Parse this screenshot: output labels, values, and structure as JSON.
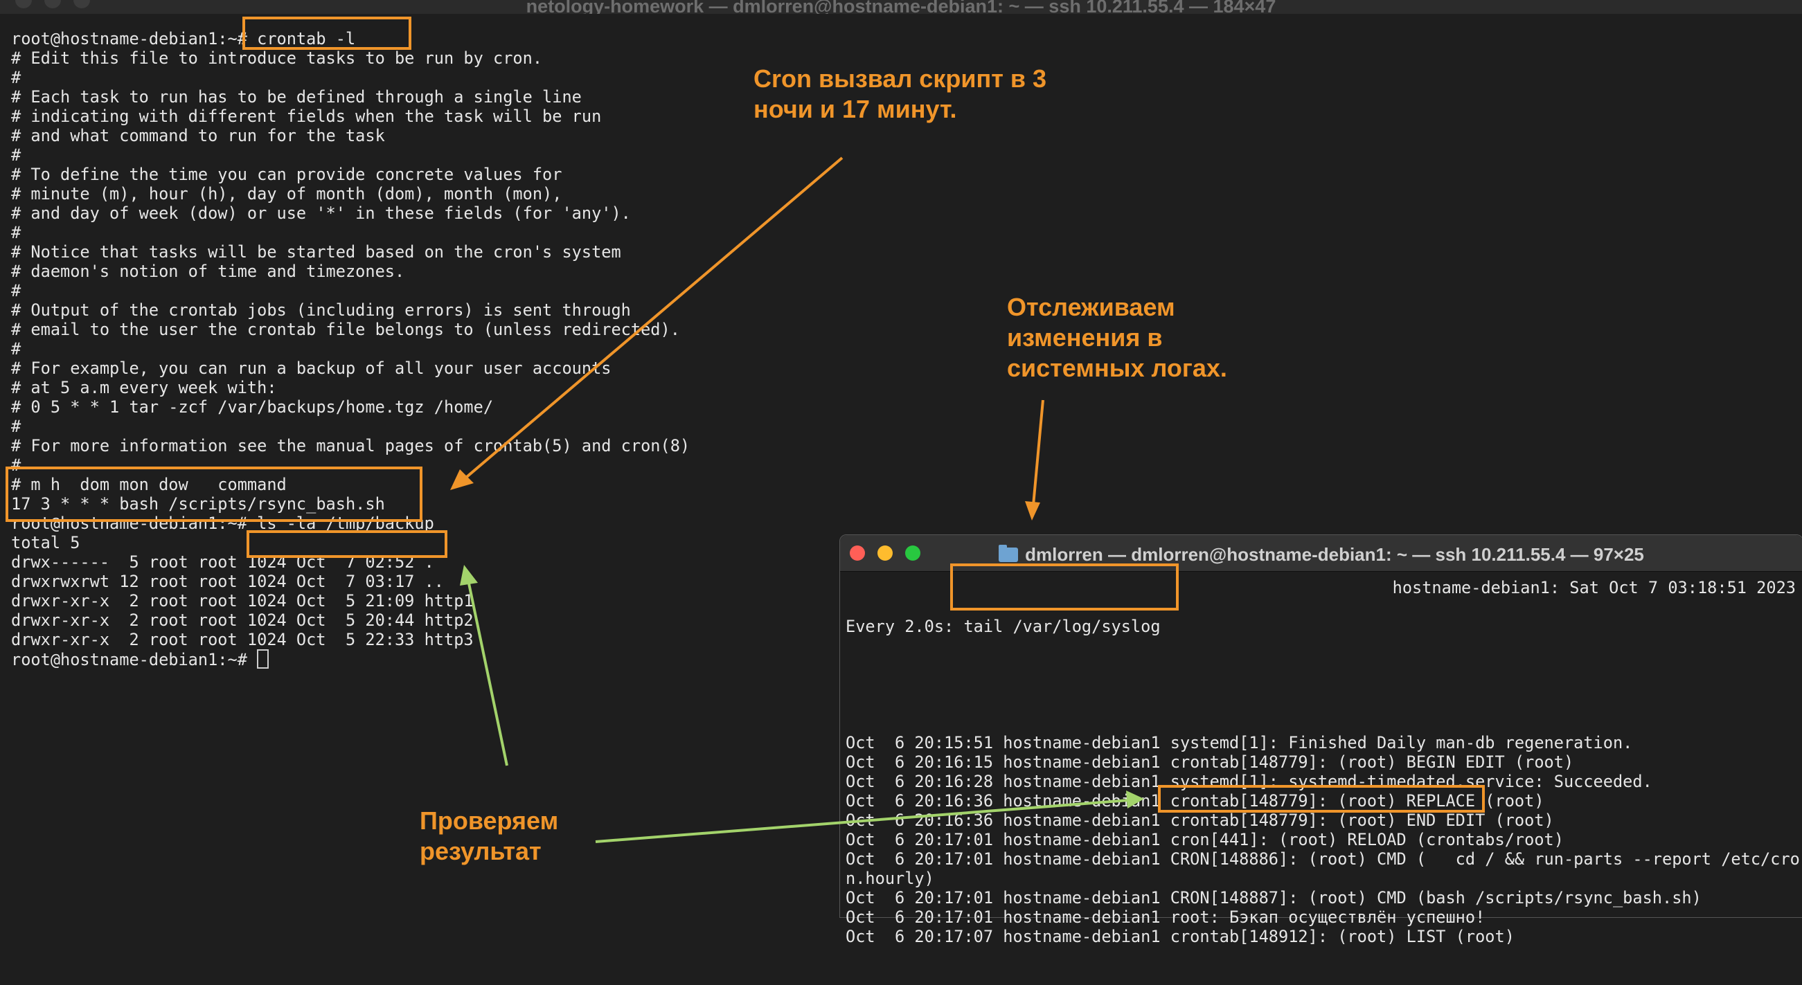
{
  "main_window": {
    "title": "netology-homework — dmlorren@hostname-debian1: ~ — ssh 10.211.55.4 — 184×47",
    "lines": [
      "root@hostname-debian1:~# crontab -l",
      "# Edit this file to introduce tasks to be run by cron.",
      "#",
      "# Each task to run has to be defined through a single line",
      "# indicating with different fields when the task will be run",
      "# and what command to run for the task",
      "#",
      "# To define the time you can provide concrete values for",
      "# minute (m), hour (h), day of month (dom), month (mon),",
      "# and day of week (dow) or use '*' in these fields (for 'any').",
      "#",
      "# Notice that tasks will be started based on the cron's system",
      "# daemon's notion of time and timezones.",
      "#",
      "# Output of the crontab jobs (including errors) is sent through",
      "# email to the user the crontab file belongs to (unless redirected).",
      "#",
      "# For example, you can run a backup of all your user accounts",
      "# at 5 a.m every week with:",
      "# 0 5 * * 1 tar -zcf /var/backups/home.tgz /home/",
      "#",
      "# For more information see the manual pages of crontab(5) and cron(8)",
      "#",
      "# m h  dom mon dow   command",
      "17 3 * * * bash /scripts/rsync_bash.sh",
      "root@hostname-debian1:~# ls -la /tmp/backup",
      "total 5",
      "drwx------  5 root root 1024 Oct  7 02:52 .",
      "drwxrwxrwt 12 root root 1024 Oct  7 03:17 ..",
      "drwxr-xr-x  2 root root 1024 Oct  5 21:09 http1",
      "drwxr-xr-x  2 root root 1024 Oct  5 20:44 http2",
      "drwxr-xr-x  2 root root 1024 Oct  5 22:33 http3",
      "root@hostname-debian1:~# "
    ]
  },
  "syslog_window": {
    "title": "dmlorren — dmlorren@hostname-debian1: ~ — ssh 10.211.55.4 — 97×25",
    "header_left": "Every 2.0s: tail /var/log/syslog",
    "header_right": "hostname-debian1: Sat Oct  7 03:18:51 2023",
    "lines": [
      "Oct  6 20:15:51 hostname-debian1 systemd[1]: Finished Daily man-db regeneration.",
      "Oct  6 20:16:15 hostname-debian1 crontab[148779]: (root) BEGIN EDIT (root)",
      "Oct  6 20:16:28 hostname-debian1 systemd[1]: systemd-timedated.service: Succeeded.",
      "Oct  6 20:16:36 hostname-debian1 crontab[148779]: (root) REPLACE (root)",
      "Oct  6 20:16:36 hostname-debian1 crontab[148779]: (root) END EDIT (root)",
      "Oct  6 20:17:01 hostname-debian1 cron[441]: (root) RELOAD (crontabs/root)",
      "Oct  6 20:17:01 hostname-debian1 CRON[148886]: (root) CMD (   cd / && run-parts --report /etc/cro",
      "n.hourly)",
      "Oct  6 20:17:01 hostname-debian1 CRON[148887]: (root) CMD (bash /scripts/rsync_bash.sh)",
      "Oct  6 20:17:01 hostname-debian1 root: Бэкап осуществлён успешно!",
      "Oct  6 20:17:07 hostname-debian1 crontab[148912]: (root) LIST (root)"
    ]
  },
  "annotations": {
    "cron_note": "Cron вызвал скрипт в 3\nночи и 17 минут.",
    "syslog_note": "Отслеживаем\nизменения в\nсистемных логах.",
    "result_note": "Проверяем\nрезультат"
  },
  "colors": {
    "annotation": "#f0952a",
    "result_arrow": "#a3d36b",
    "terminal_bg": "#1e1e1e",
    "terminal_text": "#e6e6e6"
  }
}
